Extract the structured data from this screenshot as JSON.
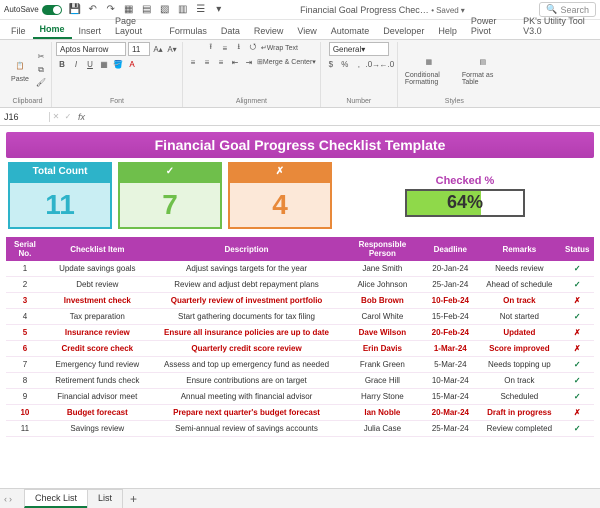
{
  "titlebar": {
    "autosave_label": "AutoSave",
    "autosave_state": "On",
    "filename": "Financial Goal Progress Chec…",
    "saved_label": "Saved",
    "search_placeholder": "Search"
  },
  "menu": {
    "tabs": [
      "File",
      "Home",
      "Insert",
      "Page Layout",
      "Formulas",
      "Data",
      "Review",
      "View",
      "Automate",
      "Developer",
      "Help",
      "Power Pivot",
      "PK's Utility Tool V3.0"
    ],
    "active": "Home"
  },
  "ribbon": {
    "clipboard": {
      "paste": "Paste",
      "label": "Clipboard"
    },
    "font": {
      "name": "Aptos Narrow",
      "size": "11",
      "label": "Font"
    },
    "alignment": {
      "wrap": "Wrap Text",
      "merge": "Merge & Center",
      "label": "Alignment"
    },
    "number": {
      "format": "General",
      "label": "Number"
    },
    "styles": {
      "cond": "Conditional Formatting",
      "table": "Format as Table",
      "label": "Styles"
    }
  },
  "formula": {
    "cell": "J16",
    "fx": "fx"
  },
  "banner": "Financial Goal Progress Checklist Template",
  "cards": {
    "total_label": "Total Count",
    "total_value": "11",
    "checked_symbol": "✓",
    "checked_value": "7",
    "unchecked_symbol": "✗",
    "unchecked_value": "4",
    "pct_label": "Checked %",
    "pct_value": "64%"
  },
  "table": {
    "headers": [
      "Serial No.",
      "Checklist Item",
      "Description",
      "Responsible Person",
      "Deadline",
      "Remarks",
      "Status"
    ],
    "rows": [
      {
        "n": "1",
        "item": "Update savings goals",
        "desc": "Adjust savings targets for the year",
        "person": "Jane Smith",
        "deadline": "20-Jan-24",
        "remarks": "Needs review",
        "status": true,
        "red": false
      },
      {
        "n": "2",
        "item": "Debt review",
        "desc": "Review and adjust debt repayment plans",
        "person": "Alice Johnson",
        "deadline": "25-Jan-24",
        "remarks": "Ahead of schedule",
        "status": true,
        "red": false
      },
      {
        "n": "3",
        "item": "Investment check",
        "desc": "Quarterly review of investment portfolio",
        "person": "Bob Brown",
        "deadline": "10-Feb-24",
        "remarks": "On track",
        "status": false,
        "red": true
      },
      {
        "n": "4",
        "item": "Tax preparation",
        "desc": "Start gathering documents for tax filing",
        "person": "Carol White",
        "deadline": "15-Feb-24",
        "remarks": "Not started",
        "status": true,
        "red": false
      },
      {
        "n": "5",
        "item": "Insurance review",
        "desc": "Ensure all insurance policies are up to date",
        "person": "Dave Wilson",
        "deadline": "20-Feb-24",
        "remarks": "Updated",
        "status": false,
        "red": true
      },
      {
        "n": "6",
        "item": "Credit score check",
        "desc": "Quarterly credit score review",
        "person": "Erin Davis",
        "deadline": "1-Mar-24",
        "remarks": "Score improved",
        "status": false,
        "red": true
      },
      {
        "n": "7",
        "item": "Emergency fund review",
        "desc": "Assess and top up emergency fund as needed",
        "person": "Frank Green",
        "deadline": "5-Mar-24",
        "remarks": "Needs topping up",
        "status": true,
        "red": false
      },
      {
        "n": "8",
        "item": "Retirement funds check",
        "desc": "Ensure contributions are on target",
        "person": "Grace Hill",
        "deadline": "10-Mar-24",
        "remarks": "On track",
        "status": true,
        "red": false
      },
      {
        "n": "9",
        "item": "Financial advisor meet",
        "desc": "Annual meeting with financial advisor",
        "person": "Harry Stone",
        "deadline": "15-Mar-24",
        "remarks": "Scheduled",
        "status": true,
        "red": false
      },
      {
        "n": "10",
        "item": "Budget forecast",
        "desc": "Prepare next quarter's budget forecast",
        "person": "Ian Noble",
        "deadline": "20-Mar-24",
        "remarks": "Draft in progress",
        "status": false,
        "red": true
      },
      {
        "n": "11",
        "item": "Savings review",
        "desc": "Semi-annual review of savings accounts",
        "person": "Julia Case",
        "deadline": "25-Mar-24",
        "remarks": "Review completed",
        "status": true,
        "red": false
      }
    ]
  },
  "sheets": {
    "tabs": [
      "Check List",
      "List"
    ],
    "active": "Check List"
  }
}
